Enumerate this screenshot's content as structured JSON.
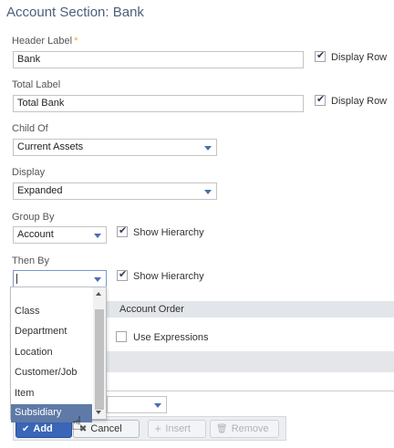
{
  "page": {
    "title": "Account Section: Bank"
  },
  "header_label": {
    "label": "Header Label",
    "required_mark": "*",
    "value": "Bank",
    "display_row": "Display Row"
  },
  "total_label": {
    "label": "Total Label",
    "value": "Total Bank",
    "display_row": "Display Row"
  },
  "child_of": {
    "label": "Child Of",
    "value": "Current Assets"
  },
  "display": {
    "label": "Display",
    "value": "Expanded"
  },
  "group_by": {
    "label": "Group By",
    "value": "Account",
    "hierarchy": "Show Hierarchy"
  },
  "then_by": {
    "label": "Then By",
    "value": "",
    "hierarchy": "Show Hierarchy"
  },
  "tab": {
    "account_order": "Account Order"
  },
  "use_expressions": "Use Expressions",
  "dropdown": {
    "options": [
      "Class",
      "Department",
      "Location",
      "Customer/Job",
      "Item",
      "Subsidiary"
    ],
    "selected": "Subsidiary"
  },
  "buttons": {
    "add": "Add",
    "cancel": "Cancel",
    "insert": "Insert",
    "remove": "Remove"
  },
  "icons": {
    "check": "check-icon",
    "close": "close-icon",
    "plus": "plus-icon",
    "trash": "trash-icon",
    "pointer": "hand-cursor-icon"
  },
  "colors": {
    "title": "#4d5f79",
    "primary_button": "#3a66b8",
    "selected_option": "#5f7aa6",
    "required": "#f5a623"
  }
}
